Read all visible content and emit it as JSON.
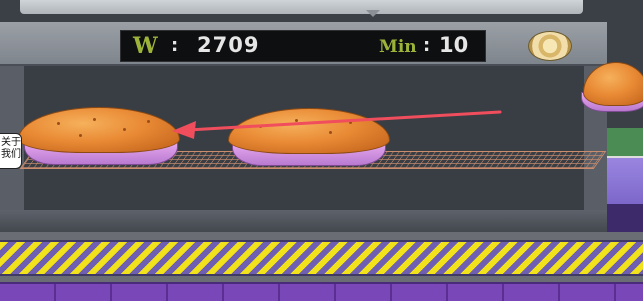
{
  "hud": {
    "w_label": "W",
    "w_sep": ":",
    "w_value": "2709",
    "min_label": "Min",
    "min_sep": ":",
    "min_value": "10"
  },
  "side_tab": {
    "label": "关于我们"
  },
  "icons": {
    "settings": "gear-button-icon",
    "arrow": "hint-arrow-icon"
  },
  "colors": {
    "hud_label": "#9cb33a",
    "hint_arrow": "#f04d5d",
    "belt_yellow": "#f1e21c",
    "pan_pink": "#e7a9f0"
  }
}
